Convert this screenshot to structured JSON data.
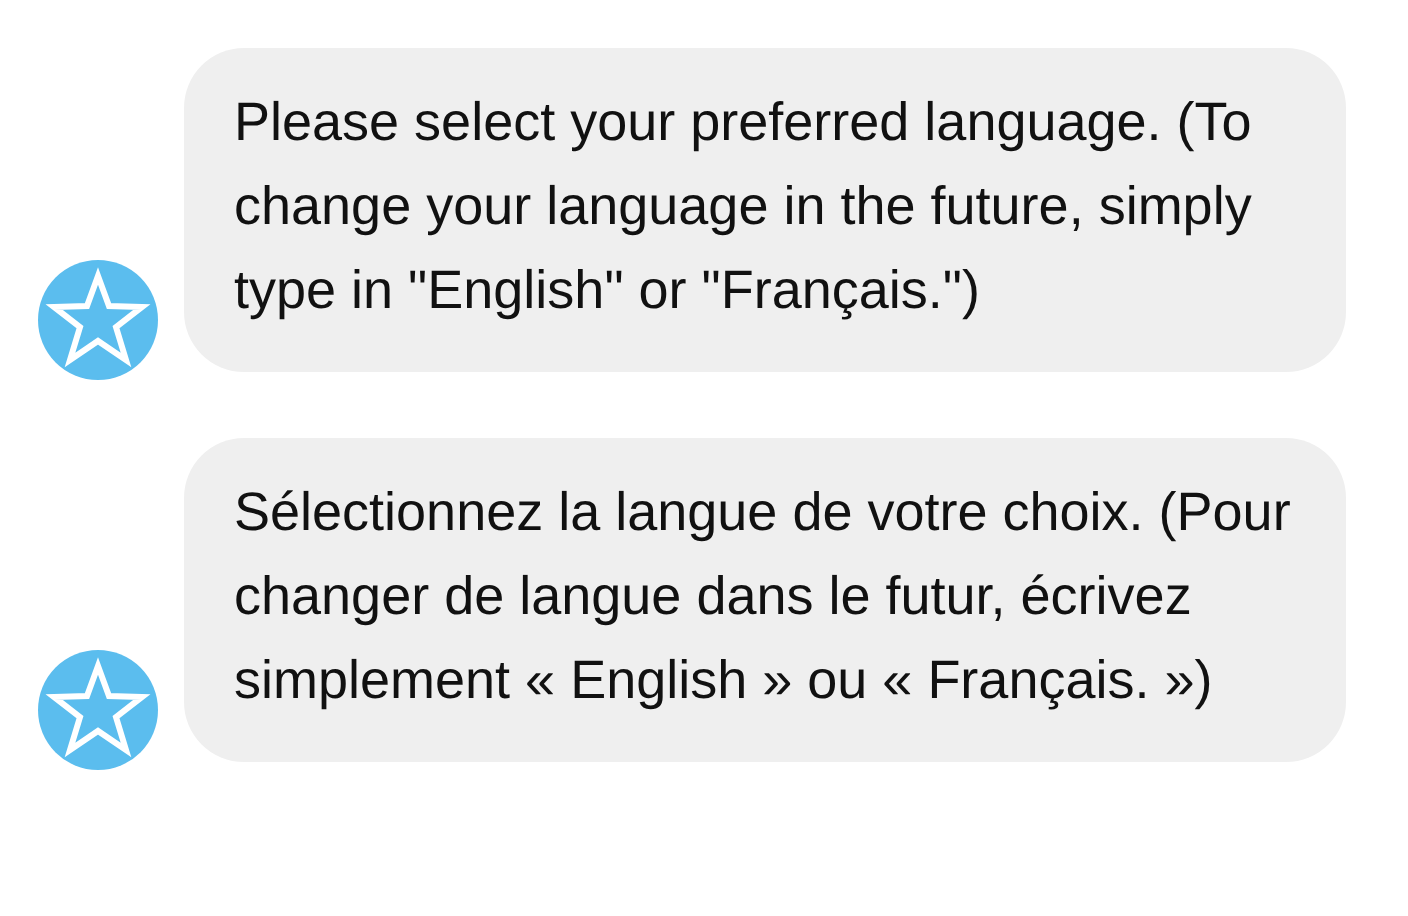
{
  "messages": [
    {
      "text": "Please select your preferred language. (To change your language in the future, simply type in \"English\" or \"Français.\")"
    },
    {
      "text": "Sélectionnez la langue de votre choix. (Pour changer de langue dans le futur, écrivez simplement « English » ou « Français. »)"
    }
  ]
}
